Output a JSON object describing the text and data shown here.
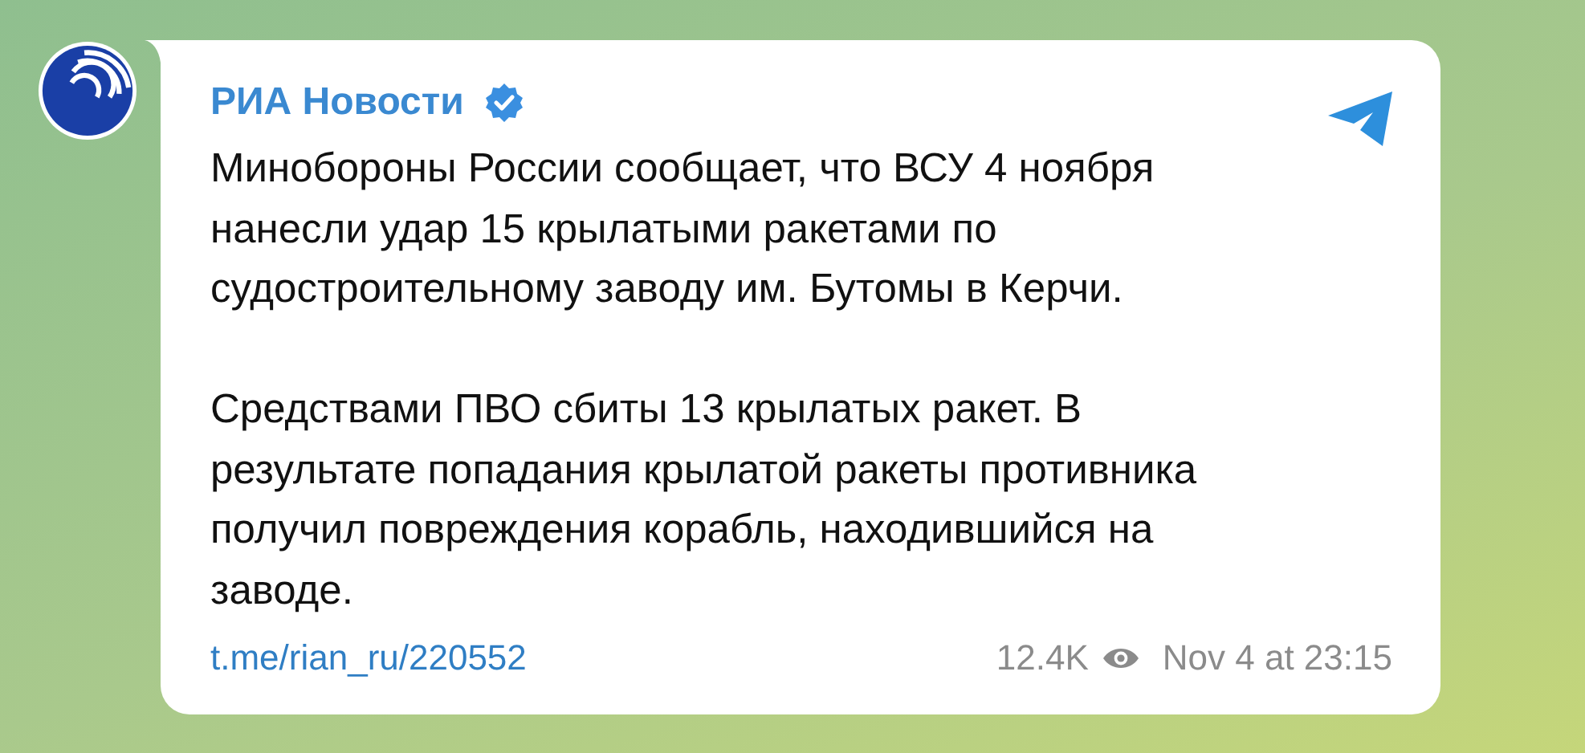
{
  "channel": {
    "name": "РИА Новости",
    "verified": true
  },
  "post": {
    "paragraphs": [
      "Минобороны России сообщает, что ВСУ 4 ноября\nнанесли удар 15 крылатыми ракетами по\nсудостроительному заводу им. Бутомы в Керчи.",
      "Средствами ПВО сбиты 13 крылатых ракет. В\nрезультате попадания крылатой ракеты противника\nполучил повреждения корабль, находившийся на\nзаводе."
    ],
    "link": "t.me/rian_ru/220552",
    "views": "12.4K",
    "date": "Nov 4 at 23:15"
  }
}
